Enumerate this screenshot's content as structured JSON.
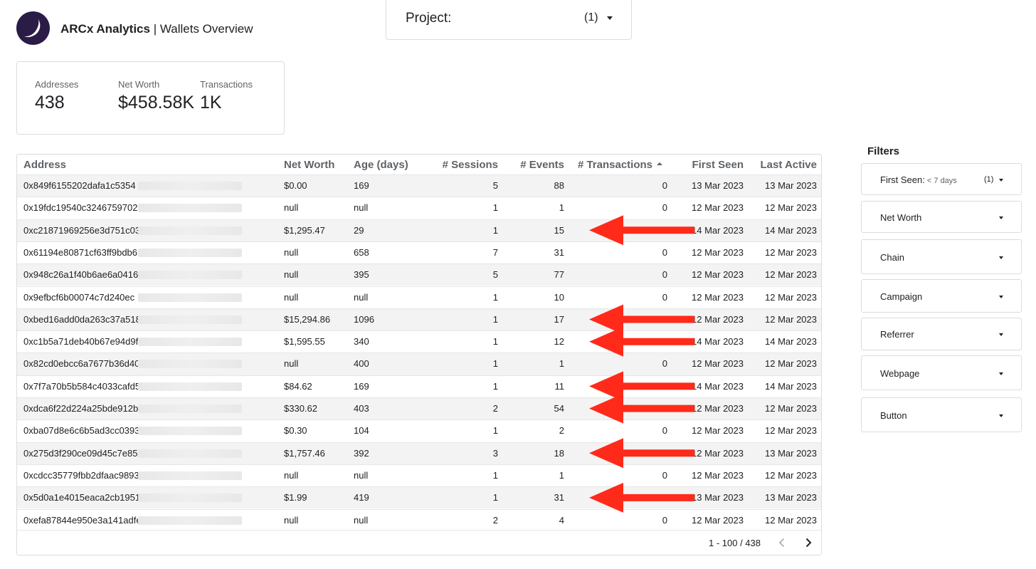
{
  "header": {
    "brand": "ARCx Analytics",
    "separator": " | ",
    "page": "Wallets Overview",
    "logo_icon": "moon-icon",
    "logo_color": "#2b1b47"
  },
  "project": {
    "label": "Project:",
    "count": "(1)"
  },
  "kpis": [
    {
      "label": "Addresses",
      "value": "438"
    },
    {
      "label": "Net Worth",
      "value": "$458.58K"
    },
    {
      "label": "Transactions",
      "value": "1K"
    }
  ],
  "table": {
    "columns": [
      "Address",
      "Net Worth",
      "Age (days)",
      "# Sessions",
      "# Events",
      "# Transactions",
      "First Seen",
      "Last Active"
    ],
    "sorted_column": "# Transactions",
    "rows": [
      [
        "0x849f6155202dafa1c5354",
        "$0.00",
        "169",
        "5",
        "88",
        "0",
        "13 Mar 2023",
        "13 Mar 2023"
      ],
      [
        "0x19fdc19540c3246759702",
        "null",
        "null",
        "1",
        "1",
        "0",
        "12 Mar 2023",
        "12 Mar 2023"
      ],
      [
        "0xc21871969256e3d751c03",
        "$1,295.47",
        "29",
        "1",
        "15",
        "0",
        "14 Mar 2023",
        "14 Mar 2023"
      ],
      [
        "0x61194e80871cf63ff9bdb6",
        "null",
        "658",
        "7",
        "31",
        "0",
        "12 Mar 2023",
        "12 Mar 2023"
      ],
      [
        "0x948c26a1f40b6ae6a0416",
        "null",
        "395",
        "5",
        "77",
        "0",
        "12 Mar 2023",
        "12 Mar 2023"
      ],
      [
        "0x9efbcf6b00074c7d240ec",
        "null",
        "null",
        "1",
        "10",
        "0",
        "12 Mar 2023",
        "12 Mar 2023"
      ],
      [
        "0xbed16add0da263c37a518",
        "$15,294.86",
        "1096",
        "1",
        "17",
        "0",
        "12 Mar 2023",
        "12 Mar 2023"
      ],
      [
        "0xc1b5a71deb40b67e94d9f",
        "$1,595.55",
        "340",
        "1",
        "12",
        "0",
        "14 Mar 2023",
        "14 Mar 2023"
      ],
      [
        "0x82cd0ebcc6a7677b36d40",
        "null",
        "400",
        "1",
        "1",
        "0",
        "12 Mar 2023",
        "12 Mar 2023"
      ],
      [
        "0x7f7a70b5b584c4033cafd5",
        "$84.62",
        "169",
        "1",
        "11",
        "0",
        "14 Mar 2023",
        "14 Mar 2023"
      ],
      [
        "0xdca6f22d224a25bde912b",
        "$330.62",
        "403",
        "2",
        "54",
        "0",
        "12 Mar 2023",
        "12 Mar 2023"
      ],
      [
        "0xba07d8e6c6b5ad3cc0393",
        "$0.30",
        "104",
        "1",
        "2",
        "0",
        "12 Mar 2023",
        "12 Mar 2023"
      ],
      [
        "0x275d3f290ce09d45c7e85",
        "$1,757.46",
        "392",
        "3",
        "18",
        "0",
        "12 Mar 2023",
        "13 Mar 2023"
      ],
      [
        "0xcdcc35779fbb2dfaac9893",
        "null",
        "null",
        "1",
        "1",
        "0",
        "12 Mar 2023",
        "12 Mar 2023"
      ],
      [
        "0x5d0a1e4015eaca2cb1951",
        "$1.99",
        "419",
        "1",
        "31",
        "0",
        "13 Mar 2023",
        "13 Mar 2023"
      ],
      [
        "0xefa87844e950e3a141adfe",
        "null",
        "null",
        "2",
        "4",
        "0",
        "12 Mar 2023",
        "12 Mar 2023"
      ]
    ],
    "pagination": "1 - 100 / 438"
  },
  "annotations": {
    "arrow_color": "#ff2a1a",
    "arrow_rows": [
      2,
      6,
      7,
      9,
      10,
      12,
      14
    ]
  },
  "filters": {
    "heading": "Filters",
    "items": [
      {
        "label": "First Seen:",
        "sub": " < 7 days",
        "count": "(1)"
      },
      {
        "label": "Net Worth"
      },
      {
        "label": "Chain"
      },
      {
        "label": "Campaign"
      },
      {
        "label": "Referrer"
      },
      {
        "label": "Webpage"
      },
      {
        "label": "Button"
      }
    ]
  }
}
